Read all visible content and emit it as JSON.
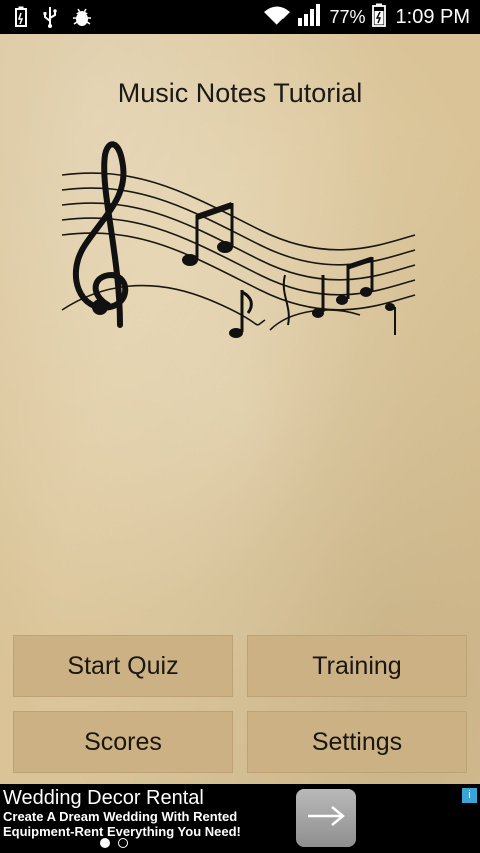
{
  "status_bar": {
    "icons": [
      "battery-saver-icon",
      "usb-icon",
      "debug-icon",
      "wifi-icon",
      "signal-icon",
      "battery-icon"
    ],
    "battery_percent": "77%",
    "time": "1:09 PM"
  },
  "app": {
    "title": "Music Notes Tutorial",
    "artwork": "music-notes-staff-icon"
  },
  "buttons": {
    "start_quiz": "Start Quiz",
    "training": "Training",
    "scores": "Scores",
    "settings": "Settings"
  },
  "ad": {
    "title": "Wedding Decor Rental",
    "description": "Create A Dream Wedding With Rented Equipment-Rent Everything You Need!",
    "arrow_icon": "arrow-right-icon",
    "info_icon": "ad-info-icon"
  },
  "pager": {
    "pages": 2,
    "active": 1
  },
  "colors": {
    "paper": "#dfcca4",
    "button": "#cbb184",
    "status_bar": "#000000"
  }
}
